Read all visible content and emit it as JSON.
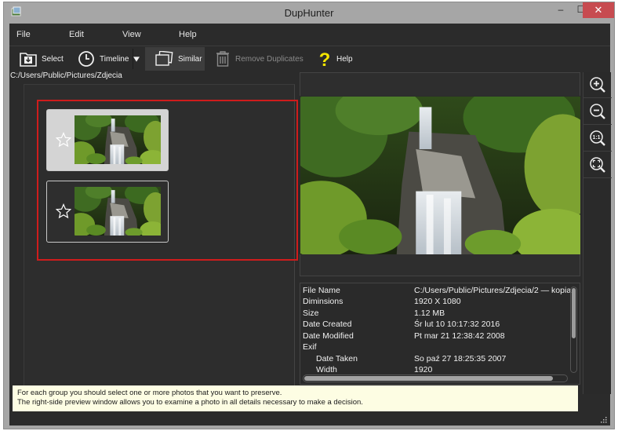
{
  "window": {
    "title": "DupHunter",
    "controls": {
      "minimize": "–",
      "maximize": "☐",
      "close": "✕"
    }
  },
  "menu": [
    "File",
    "Edit",
    "View",
    "Help"
  ],
  "toolbar": {
    "select": "Select",
    "timeline": "Timeline",
    "similar": "Similar",
    "remove_duplicates": "Remove Duplicates",
    "help": "Help"
  },
  "path": "C:/Users/Public/Pictures/Zdjecia",
  "group": {
    "items": [
      {
        "starred": false,
        "selected": true
      },
      {
        "starred": false,
        "selected": false
      }
    ]
  },
  "zoom_tools": [
    {
      "icon": "zoom-in-icon",
      "label": "+"
    },
    {
      "icon": "zoom-out-icon",
      "label": "−"
    },
    {
      "icon": "zoom-actual-size-icon",
      "label": "1:1"
    },
    {
      "icon": "zoom-fit-icon",
      "label": "fit"
    }
  ],
  "info": {
    "rows": [
      {
        "key": "File Name",
        "value": "C:/Users/Public/Pictures/Zdjecia/2 — kopia",
        "indent": false
      },
      {
        "key": "Diminsions",
        "value": "1920 X 1080",
        "indent": false
      },
      {
        "key": "Size",
        "value": "1.12 MB",
        "indent": false
      },
      {
        "key": "Date Created",
        "value": "Śr lut 10 10:17:32 2016",
        "indent": false
      },
      {
        "key": "Date Modified",
        "value": "Pt mar 21 12:38:42 2008",
        "indent": false
      },
      {
        "key": "Exif",
        "value": "",
        "indent": false
      },
      {
        "key": "Date Taken",
        "value": "So paź 27 18:25:35 2007",
        "indent": true
      },
      {
        "key": "Width",
        "value": "1920",
        "indent": true
      }
    ]
  },
  "hint": {
    "line1": "For each group you should select one or more photos that you want to preserve.",
    "line2": "The right-side preview window allows you to examine a photo in all details necessary to make a decision."
  },
  "colors": {
    "group_border": "#cf1c1c",
    "help_icon": "#f2e400",
    "close_button": "#c74b50",
    "hint_background": "#fdfde3"
  }
}
